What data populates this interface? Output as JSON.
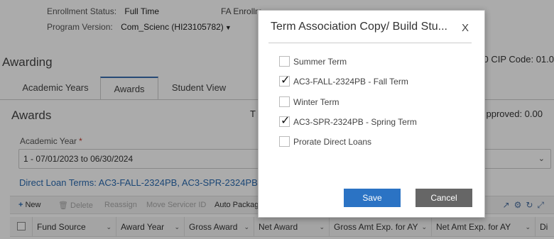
{
  "header": {
    "enrollment_status_label": "Enrollment Status:",
    "enrollment_status_value": "Full Time",
    "fa_enrollment_label": "FA Enrollm",
    "program_version_label": "Program Version:",
    "program_version_value": "Com_Scienc (HI23105782)"
  },
  "awarding": {
    "title": "Awarding",
    "cip_code": "0 CIP Code: 01.0"
  },
  "tabs": [
    {
      "label": "Academic Years"
    },
    {
      "label": "Awards"
    },
    {
      "label": "Student View"
    }
  ],
  "awards": {
    "title": "Awards",
    "t_cut": "T",
    "approved": "pproved: 0.00",
    "academic_year_label": "Academic Year",
    "required_marker": "*",
    "academic_year_value": "1 - 07/01/2023 to 06/30/2024",
    "direct_loan_terms": "Direct Loan Terms: AC3-FALL-2324PB, AC3-SPR-2324PB"
  },
  "toolbar": {
    "new": "New",
    "delete": "Delete",
    "reassign": "Reassign",
    "move_servicer": "Move Servicer ID",
    "auto_package": "Auto Package"
  },
  "grid_columns": [
    {
      "label": "Fund Source"
    },
    {
      "label": "Award Year"
    },
    {
      "label": "Gross Award"
    },
    {
      "label": "Net Award"
    },
    {
      "label": "Gross Amt Exp. for AY"
    },
    {
      "label": "Net Amt Exp. for AY"
    },
    {
      "label": "Di"
    }
  ],
  "modal": {
    "title": "Term Association Copy/ Build Stu...",
    "close": "X",
    "options": [
      {
        "label": "Summer Term",
        "checked": false
      },
      {
        "label": "AC3-FALL-2324PB - Fall Term",
        "checked": true
      },
      {
        "label": "Winter Term",
        "checked": false
      },
      {
        "label": "AC3-SPR-2324PB - Spring Term",
        "checked": true
      },
      {
        "label": "Prorate Direct Loans",
        "checked": false
      }
    ],
    "save": "Save",
    "cancel": "Cancel"
  },
  "colors": {
    "accent": "#2b73c4",
    "link": "#2a6ab0",
    "cancel": "#666666"
  }
}
